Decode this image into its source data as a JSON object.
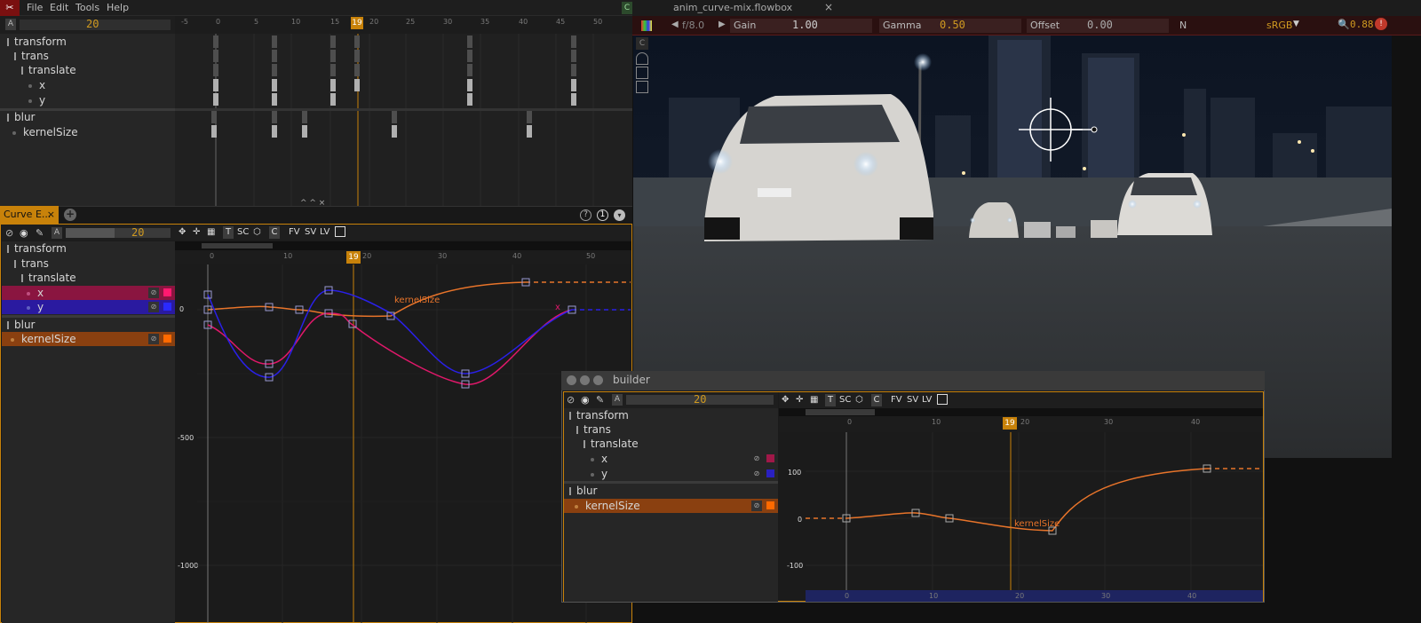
{
  "app": {
    "icon": "flowbox-logo-icon",
    "menu": [
      "File",
      "Edit",
      "Tools",
      "Help"
    ],
    "c_tab": "C"
  },
  "dope": {
    "mode_btn": "A",
    "frame": "20",
    "ruler_ticks": [
      "-5",
      "0",
      "5",
      "10",
      "15",
      "20",
      "25",
      "30",
      "35",
      "40",
      "45",
      "50"
    ],
    "playhead": "19",
    "rows": [
      {
        "label": "transform",
        "kind": "group"
      },
      {
        "label": "trans",
        "kind": "group"
      },
      {
        "label": "translate",
        "kind": "group"
      },
      {
        "label": "x",
        "kind": "leaf"
      },
      {
        "label": "y",
        "kind": "leaf"
      },
      {
        "label": "blur",
        "kind": "group"
      },
      {
        "label": "kernelSize",
        "kind": "leaf"
      }
    ],
    "collapse_glyphs": "^ ^ ×"
  },
  "curve_editor": {
    "tab_label": "Curve E...",
    "tab_close": "×",
    "add_tab": "+",
    "help": "?",
    "info": "1",
    "menu": "▾",
    "frame": "20",
    "mode_btn": "A",
    "toolbar": [
      "T",
      "SC",
      "C",
      "FV",
      "SV",
      "LV"
    ],
    "ruler_ticks": [
      "0",
      "10",
      "20",
      "30",
      "40",
      "50"
    ],
    "playhead": "19",
    "y_ticks": [
      "0",
      "-500",
      "-1000"
    ],
    "curve_label": "kernelSize",
    "x_marker": "x",
    "rows": [
      {
        "label": "transform"
      },
      {
        "label": "trans"
      },
      {
        "label": "translate"
      },
      {
        "label": "x",
        "color": "#e0186a"
      },
      {
        "label": "y",
        "color": "#2a20e8"
      },
      {
        "label": "blur"
      },
      {
        "label": "kernelSize",
        "color": "#ff6a00"
      }
    ]
  },
  "viewer": {
    "filename": "anim_curve-mix.flowbox",
    "close": "×",
    "fstop": "f/8.0",
    "gain_label": "Gain",
    "gain_value": "1.00",
    "gamma_label": "Gamma",
    "gamma_value": "0.50",
    "offset_label": "Offset",
    "offset_value": "0.00",
    "channel": "N",
    "colorspace": "sRGB",
    "zoom": "0.88",
    "side_btn": "C"
  },
  "builder": {
    "title": "builder",
    "frame": "20",
    "mode_btn": "A",
    "toolbar": [
      "T",
      "SC",
      "C",
      "FV",
      "SV",
      "LV"
    ],
    "ruler_ticks": [
      "0",
      "10",
      "20",
      "30",
      "40"
    ],
    "playhead": "19",
    "y_ticks": [
      "100",
      "0",
      "-100"
    ],
    "bottom_ticks": [
      "0",
      "10",
      "20",
      "30",
      "40"
    ],
    "curve_label": "kernelSize",
    "rows": [
      {
        "label": "transform"
      },
      {
        "label": "trans"
      },
      {
        "label": "translate"
      },
      {
        "label": "x",
        "color": "#a01848"
      },
      {
        "label": "y",
        "color": "#2a20c0"
      },
      {
        "label": "blur"
      },
      {
        "label": "kernelSize",
        "color": "#ff6a00"
      }
    ]
  },
  "colors": {
    "accent": "#c8820a",
    "x_curve": "#e0186a",
    "y_curve": "#2a20e8",
    "kernel_curve": "#e8742a"
  }
}
